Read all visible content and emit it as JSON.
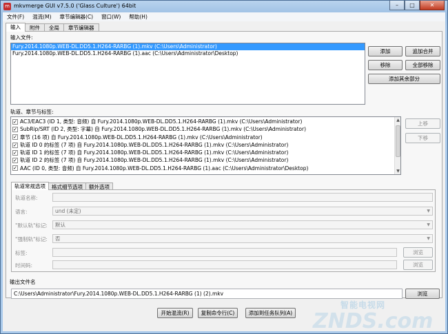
{
  "window": {
    "title": "mkvmerge GUI v7.5.0 ('Glass Culture') 64bit",
    "app_icon": "mkv-icon",
    "minimize": "–",
    "maximize": "□",
    "close": "✕"
  },
  "menu": [
    "文件(F)",
    "混流(M)",
    "章节编辑器(C)",
    "窗口(W)",
    "帮助(H)"
  ],
  "tabs": [
    "输入",
    "附件",
    "全局",
    "章节编辑器"
  ],
  "input": {
    "label": "输入文件:",
    "files": [
      "Fury.2014.1080p.WEB-DL.DD5.1.H264-RARBG (1).mkv (C:\\Users\\Administrator)",
      "Fury.2014.1080p.WEB-DL.DD5.1.H264-RARBG (1).aac (C:\\Users\\Administrator\\Desktop)"
    ],
    "buttons": {
      "add": "添加",
      "append": "追加合并",
      "remove": "移除",
      "remove_all": "全部移除",
      "add_other": "添加其余部分"
    }
  },
  "tracks": {
    "label": "轨道、章节与标签:",
    "items": [
      "AC3/EAC3 (ID 1, 类型: 音频) 自 Fury.2014.1080p.WEB-DL.DD5.1.H264-RARBG (1).mkv (C:\\Users\\Administrator)",
      "SubRip/SRT (ID 2, 类型: 字幕) 自 Fury.2014.1080p.WEB-DL.DD5.1.H264-RARBG (1).mkv (C:\\Users\\Administrator)",
      "章节 (16 项) 自 Fury.2014.1080p.WEB-DL.DD5.1.H264-RARBG (1).mkv (C:\\Users\\Administrator)",
      "轨道 ID 0 的标签 (7 项) 自 Fury.2014.1080p.WEB-DL.DD5.1.H264-RARBG (1).mkv (C:\\Users\\Administrator)",
      "轨道 ID 1 的标签 (7 项) 自 Fury.2014.1080p.WEB-DL.DD5.1.H264-RARBG (1).mkv (C:\\Users\\Administrator)",
      "轨道 ID 2 的标签 (7 项) 自 Fury.2014.1080p.WEB-DL.DD5.1.H264-RARBG (1).mkv (C:\\Users\\Administrator)",
      "AAC (ID 0, 类型: 音频) 自 Fury.2014.1080p.WEB-DL.DD5.1.H264-RARBG (1).aac (C:\\Users\\Administrator\\Desktop)"
    ],
    "check_mark": "✓",
    "up": "上移",
    "down": "下移"
  },
  "subtabs": [
    "轨道常规选项",
    "格式细节选项",
    "额外选项"
  ],
  "options": {
    "track_name_label": "轨道名称:",
    "language_label": "语言:",
    "language_value": "und (未定)",
    "default_label": "\"默认轨\"标记:",
    "default_value": "默认",
    "forced_label": "\"强制轨\"标记:",
    "forced_value": "否",
    "tags_label": "标签:",
    "timecodes_label": "时间码:",
    "browse": "浏览"
  },
  "output": {
    "label": "输出文件名",
    "value": "C:\\Users\\Administrator\\Fury.2014.1080p.WEB-DL.DD5.1.H264-RARBG (1) (2).mkv",
    "browse": "浏览"
  },
  "actions": {
    "start": "开始混流(R)",
    "copy_cmd": "复制命令行(C)",
    "add_queue": "添加到任务队列(A)"
  },
  "watermark": {
    "text": "智能电视网",
    "logo": "ZNDS.com"
  }
}
